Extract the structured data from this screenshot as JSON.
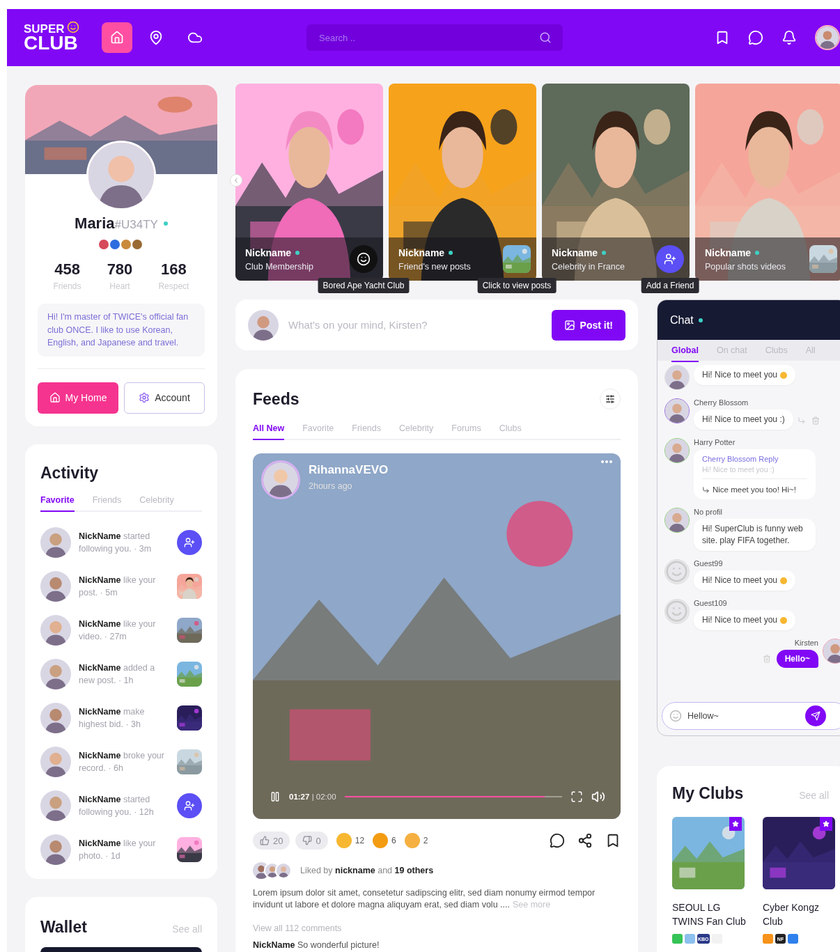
{
  "top_bar": {
    "logo": {
      "line_1": "SUPER",
      "line_2": "CLUB"
    },
    "nav": [
      {
        "kind": "home",
        "selected": true
      },
      {
        "kind": "pin",
        "selected": false
      },
      {
        "kind": "cloud",
        "selected": false
      }
    ],
    "search": {
      "placeholder": "Search .."
    },
    "actions": [
      {
        "kind": "bookmark"
      },
      {
        "kind": "chat"
      },
      {
        "kind": "bell"
      }
    ]
  },
  "profile": {
    "name": "Maria",
    "tag": "#U34TY",
    "online": true,
    "badges": [
      {
        "color": "#d64a5a"
      },
      {
        "color": "#2e6de0"
      },
      {
        "color": "#c98a3c"
      },
      {
        "color": "#9a6a34"
      }
    ],
    "stats": [
      {
        "value": "458",
        "label": "Friends"
      },
      {
        "value": "780",
        "label": "Heart"
      },
      {
        "value": "168",
        "label": "Respect"
      }
    ],
    "bio": "Hi! I'm master of TWICE's official fan club ONCE. I like to use Korean, English, and Japanese and travel.",
    "buttons": [
      {
        "kind": "primary",
        "label": "My Home"
      },
      {
        "kind": "secondary",
        "label": "Account"
      }
    ]
  },
  "activity": {
    "title": "Activity",
    "tabs": [
      {
        "label": "Favorite",
        "selected": true
      },
      {
        "label": "Friends",
        "selected": false
      },
      {
        "label": "Celebrity",
        "selected": false
      }
    ],
    "items": [
      {
        "kind": "follow",
        "text": "**NickName** started following you. · 3m"
      },
      {
        "kind": "thumb",
        "text": "**NickName** like your post. · 5m"
      },
      {
        "kind": "thumb",
        "text": "**NickName** like your video. · 27m"
      },
      {
        "kind": "thumb",
        "text": "**NickName** added a new post. · 1h"
      },
      {
        "kind": "thumb",
        "text": "**NickName** make highest bid. · 3h"
      },
      {
        "kind": "thumb",
        "text": "**NickName** broke your record. · 6h"
      },
      {
        "kind": "follow",
        "text": "**NickName** started following you. · 12h"
      },
      {
        "kind": "thumb",
        "text": "**NickName** like your photo. · 1d"
      }
    ]
  },
  "wallet": {
    "title": "Wallet",
    "see_all": "See all"
  },
  "stories": [
    {
      "kind": "logo",
      "name": "Nickname",
      "online": true,
      "subtitle": "Club Membership",
      "tooltip": "Bored Ape Yacht Club"
    },
    {
      "kind": "thumb",
      "name": "Nickname",
      "online": true,
      "subtitle": "Friend's new posts",
      "tooltip": "Click to view posts"
    },
    {
      "kind": "add",
      "name": "Nickname",
      "online": true,
      "subtitle": "Celebrity in France",
      "tooltip": "Add a Friend"
    },
    {
      "kind": "thumb",
      "name": "Nickname",
      "online": true,
      "subtitle": "Popular shots videos"
    }
  ],
  "composer": {
    "placeholder": "What's on your mind, Kirsten?",
    "button": "Post it!"
  },
  "feeds": {
    "title": "Feeds",
    "tabs": [
      {
        "label": "All New",
        "selected": true
      },
      {
        "label": "Favorite",
        "selected": false
      },
      {
        "label": "Friends",
        "selected": false
      },
      {
        "label": "Celebrity",
        "selected": false
      },
      {
        "label": "Forums",
        "selected": false
      },
      {
        "label": "Clubs",
        "selected": false
      }
    ],
    "post": {
      "author": "RihannaVEVO",
      "time": "2hours ago",
      "elapsed": "01:27",
      "duration": "| 02:00",
      "level": 0.92,
      "likes": "20",
      "dislikes": "0",
      "reactions": [
        {
          "count": "12",
          "color": "#f7b731"
        },
        {
          "count": "6",
          "color": "#f39c12"
        },
        {
          "count": "2",
          "color": "#f5b041"
        }
      ],
      "liked_by": "Liked by **nickname** and **19 others**",
      "caption": "Lorem ipsum dolor sit amet, consetetur sadipscing elitr, sed diam nonumy eirmod tempor invidunt ut labore et dolore magna aliquyam erat, sed diam volu ....",
      "see_more": "See more",
      "comments_link": "View all 112 comments",
      "comment": "**NickName** So wonderful picture!"
    }
  },
  "chat": {
    "title": "Chat",
    "online": true,
    "tabs": [
      {
        "label": "Global",
        "selected": true
      },
      {
        "label": "On chat",
        "selected": false
      },
      {
        "label": "Clubs",
        "selected": false
      },
      {
        "label": "All",
        "selected": false
      }
    ],
    "messages": [
      {
        "kind": "message",
        "text": "Hi! Nice to meet you",
        "emoji": true
      },
      {
        "kind": "message",
        "name": "Cherry Blossom",
        "text": "Hi! Nice to meet you :)",
        "actions": true
      },
      {
        "kind": "reply",
        "name": "Harry Potter",
        "quote_name": "Cherry Blossom Reply",
        "quote": "Hi! Nice to meet you :)",
        "text": "Nice meet you too! Hi~!"
      },
      {
        "kind": "message",
        "name": "No profil",
        "text": "Hi! SuperClub is funny web site. play FIFA together."
      },
      {
        "kind": "guest",
        "name": "Guest99",
        "text": "Hi! Nice to meet you",
        "emoji": true
      },
      {
        "kind": "guest",
        "name": "Guest109",
        "text": "Hi! Nice to meet you",
        "emoji": true
      },
      {
        "kind": "self",
        "name": "Kirsten",
        "text": "Hello~"
      }
    ],
    "input": {
      "value": "Hellow~"
    }
  },
  "clubs": {
    "title": "My Clubs",
    "see_all": "See all",
    "items": [
      {
        "name": "SEOUL LG TWINS Fan Club",
        "tags": [
          {
            "color": "#35c457"
          },
          {
            "color": "#8cc0ee"
          },
          {
            "color": "#2a3988",
            "label": "KBO"
          },
          {
            "color": "#f2f2f2"
          }
        ]
      },
      {
        "name": "Cyber Kongz Club",
        "tags": [
          {
            "color": "#f7931a"
          },
          {
            "color": "#222222",
            "label": "NF"
          },
          {
            "color": "#2f80ed"
          }
        ]
      }
    ]
  }
}
